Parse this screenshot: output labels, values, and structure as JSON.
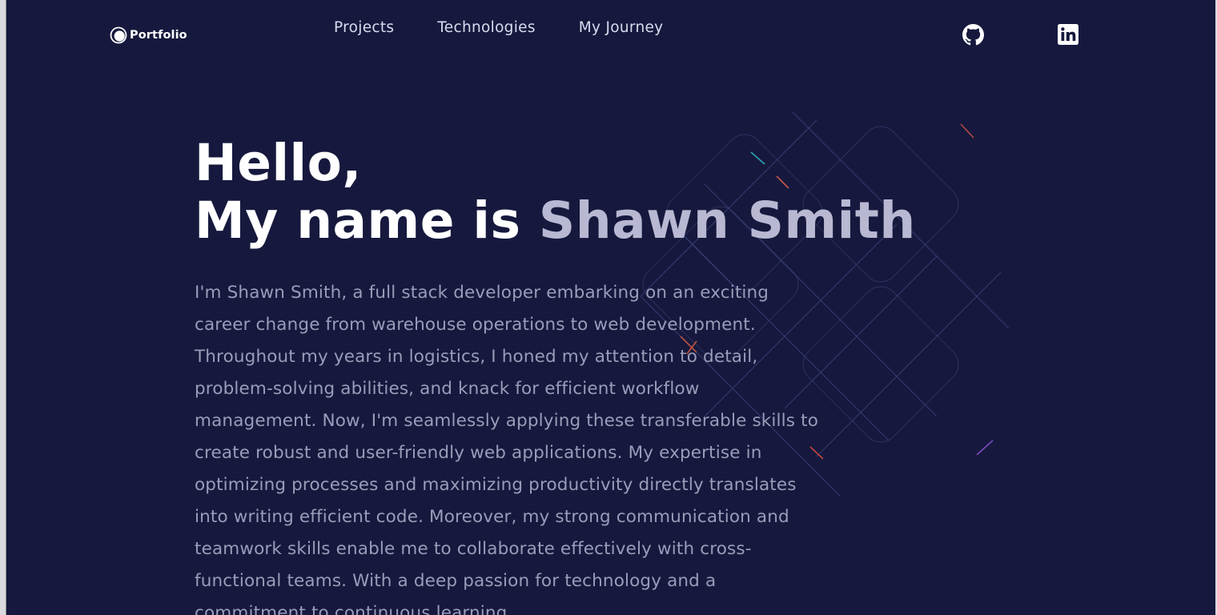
{
  "header": {
    "brand_label": "Portfolio",
    "brand_icon": "logo-icon",
    "nav": [
      {
        "label": "Projects"
      },
      {
        "label": "Technologies"
      },
      {
        "label": "My Journey"
      }
    ],
    "social": [
      {
        "icon": "github-icon"
      },
      {
        "icon": "linkedin-icon"
      }
    ]
  },
  "hero": {
    "greeting": "Hello,",
    "intro_prefix": "My name is",
    "name": "Shawn Smith",
    "bio": "I'm Shawn Smith, a full stack developer embarking on an exciting career change from warehouse operations to web development. Throughout my years in logistics, I honed my attention to detail, problem-solving abilities, and knack for efficient workflow management. Now, I'm seamlessly applying these transferable skills to create robust and user-friendly web applications. My expertise in optimizing processes and maximizing productivity directly translates into writing efficient code. Moreover, my strong communication and teamwork skills enable me to collaborate effectively with cross-functional teams. With a deep passion for technology and a commitment to continuous learning,"
  },
  "colors": {
    "background": "#16193d",
    "heading": "#ffffff",
    "heading_muted": "#b9b8d2",
    "body_text": "#9a9cb9",
    "nav_text": "#d9dcef"
  }
}
